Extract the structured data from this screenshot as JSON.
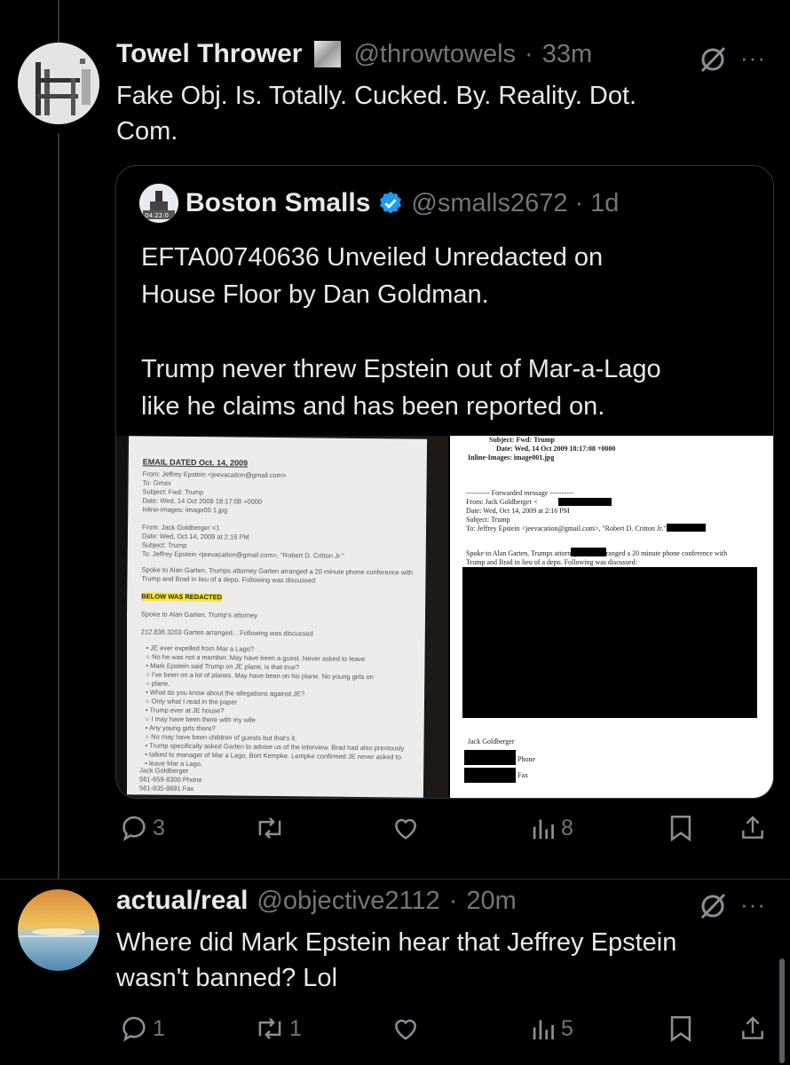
{
  "colors": {
    "background": "#000000",
    "text": "#e7e9ea",
    "muted": "#71767b",
    "verified": "#1d9bf0",
    "border": "#2f3336"
  },
  "post1": {
    "display_name": "Towel Thrower",
    "handle": "@throwtowels",
    "separator": "·",
    "time": "33m",
    "more_label": "···",
    "text_line1": "Fake Obj. Is. Totally. Cucked. By. Reality. Dot.",
    "text_line2": "Com.",
    "quote": {
      "display_name": "Boston Smalls",
      "handle": "@smalls2672",
      "separator": "·",
      "time": "1d",
      "para1_line1": "EFTA00740636 Unveiled Unredacted on",
      "para1_line2": "House Floor by Dan Goldman.",
      "para2_line1": "Trump never threw Epstein out of Mar-a-Lago",
      "para2_line2": "like he claims and has been reported on.",
      "media": {
        "left_doc": {
          "title": "EMAIL DATED Oct. 14, 2009",
          "from": "From: Jeffrey Epstein <jeevacation@gmail.com>",
          "to": "To: Gmax",
          "subject": "Subject: Fwd: Trump",
          "date": "Date: Wed, 14 Oct 2009 18:17:08 +0000",
          "inline": "Inline-images: image00 1.jpg",
          "from2": "From: Jack Goldberger <1",
          "date2": "Date: Wed, Oct 14, 2009 at 2:16 PM",
          "subject2": "Subject: Trump",
          "to2": "To: Jeffrey Epstein <jeevacation@gmail.com>, \"Robert D. Critton Jr.\"",
          "body1": "Spoke to Alan Garten, Trumps attorney Garten arranged a 20 minute phone conference with",
          "body2": "Trump and Brad in lieu of a depo. Following was discussed",
          "redacted_header": "BELOW WAS REDACTED",
          "line_a": "Spoke to Alan Garten, Trump's attorney",
          "line_b": "212.836.3203 Garten arranged... Following was discussed",
          "bullets": [
            "JE ever expelled from Mar a Lago?",
            "     No he was not a member. May have been a guest. Never asked to leave",
            "Mark Epstein said Trump on JE plane, is that true?",
            "     I've been on a lot of planes. May have been on his plane. No young girls on",
            "     plane.",
            "What do you know about the allegations against JE?",
            "     Only what I read in the paper",
            "Trump ever at JE house?",
            "     I may have been there with my wife",
            "Any young girls there?",
            "     No may have been children of guests but that's it.",
            "Trump specifically asked Garten to advise us of the interview. Brad had also previously",
            "talked to manager of Mar a Lago, Bort Kempke. Lempke confirmed JE never asked to",
            "leave Mar a Lago."
          ],
          "sig_name": "Jack Goldberger",
          "sig_phone": "561-659-8300 Phone",
          "sig_fax": "561-835-8691 Fax"
        },
        "right_doc": {
          "subject": "Subject: Fwd: Trump",
          "date": "Date: Wed, 14 Oct 2009 18:17:08 +0000",
          "inline": "Inline-Images: image001.jpg",
          "fwd": "---------- Forwarded message ----------",
          "from": "From: Jack Goldberger <",
          "date2": "Date: Wed, Oct 14, 2009 at 2:16 PM",
          "subject2": "Subject: Trump",
          "to": "To: Jeffrey Epstein <jeevacation@gmail.com>, \"Robert D. Critton Jr.\" <",
          "body1": "Spoke to Alan Garten, Trumps attorney             Garten arranged a 20 minute phone conference with",
          "body2": "Trump and Brad in lieu of a depo.  Following was discussed:",
          "sig_name": "Jack Goldberger",
          "phone_label": "Phone",
          "fax_label": "Fax"
        }
      }
    },
    "actions": {
      "replies": "3",
      "reposts": "",
      "likes": "",
      "views": "8"
    }
  },
  "post2": {
    "display_name": "actual/real",
    "handle": "@objective2112",
    "separator": "·",
    "time": "20m",
    "more_label": "···",
    "text_line1": "Where did Mark Epstein hear that Jeffrey Epstein",
    "text_line2": "wasn't banned? Lol",
    "actions": {
      "replies": "1",
      "reposts": "1",
      "likes": "",
      "views": "5"
    }
  },
  "icons": [
    "avatar-towel",
    "verified-badge-icon",
    "grok-icon",
    "more-icon",
    "reply-icon",
    "repost-icon",
    "like-icon",
    "views-icon",
    "bookmark-icon",
    "share-icon"
  ]
}
